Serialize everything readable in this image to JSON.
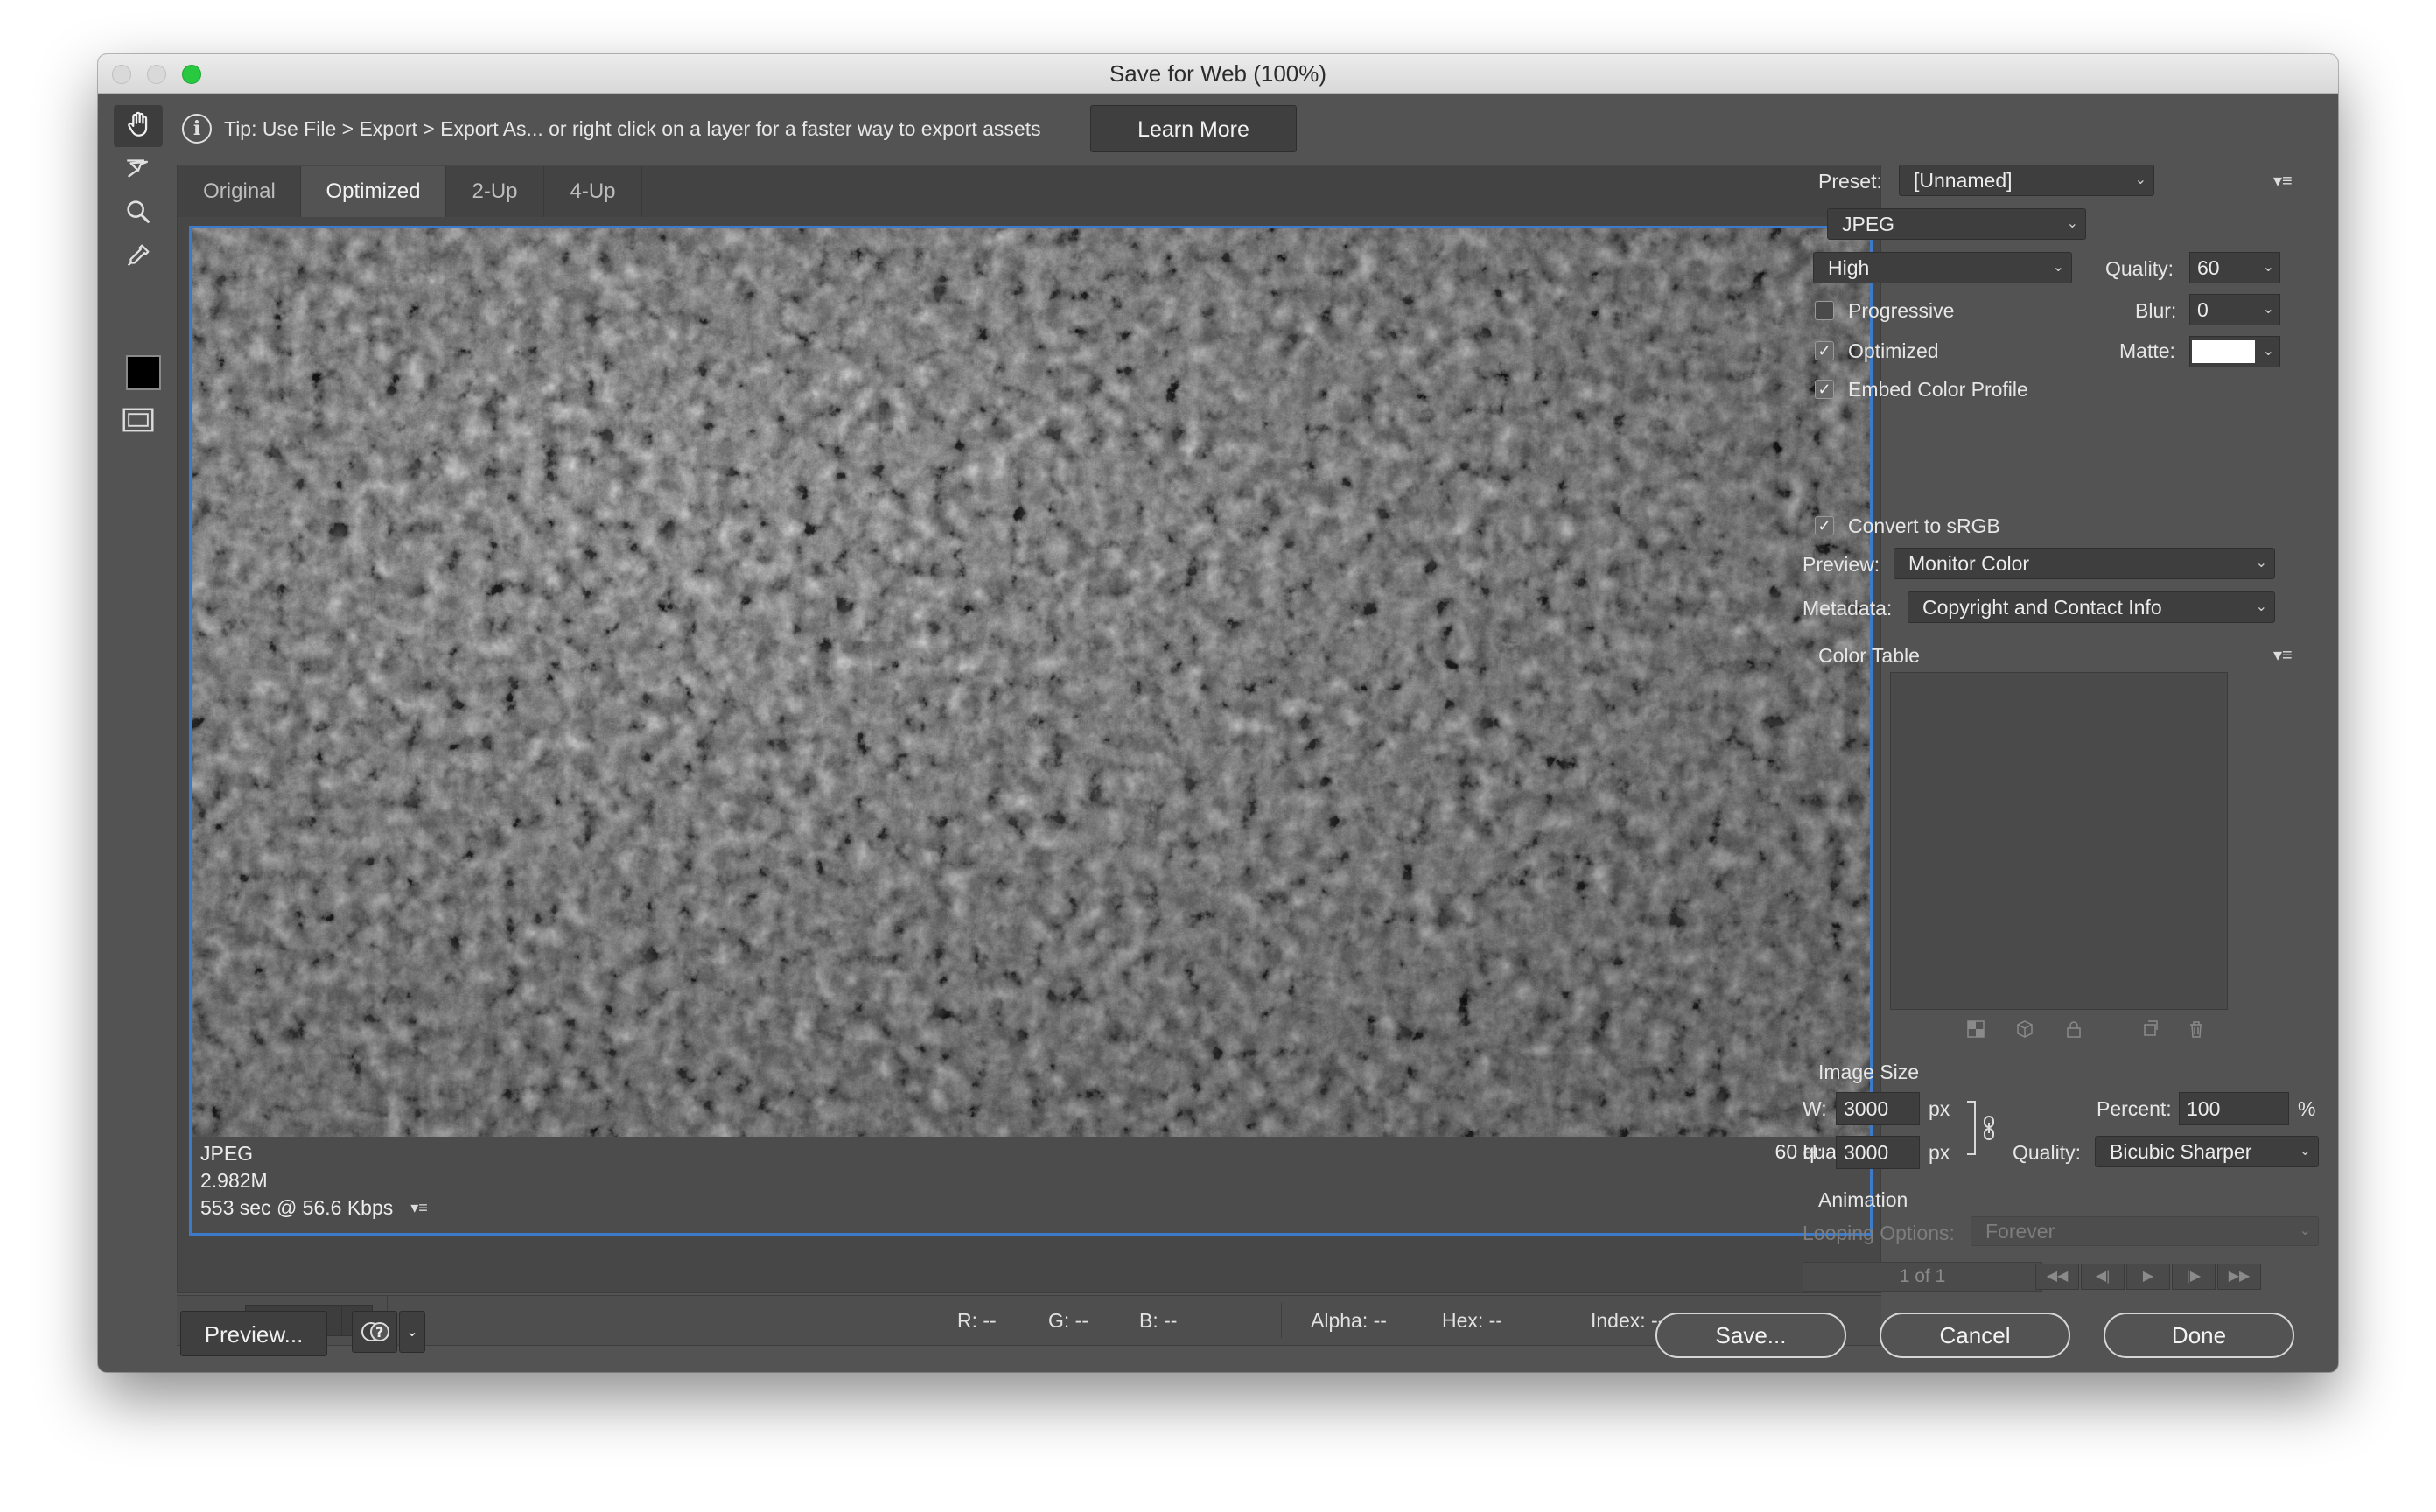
{
  "window": {
    "title": "Save for Web (100%)"
  },
  "tip": {
    "text": "Tip: Use File > Export > Export As...  or right click on a layer for a faster way to export assets",
    "button": "Learn More"
  },
  "tabs": [
    "Original",
    "Optimized",
    "2-Up",
    "4-Up"
  ],
  "active_tab": "Optimized",
  "image_info": {
    "format": "JPEG",
    "size": "2.982M",
    "time": "553 sec @ 56.6 Kbps",
    "quality": "60 quality"
  },
  "status": {
    "zoom": "100%",
    "r": "R: --",
    "g": "G: --",
    "b": "B: --",
    "alpha": "Alpha: --",
    "hex": "Hex: --",
    "index": "Index: --"
  },
  "buttons": {
    "preview": "Preview...",
    "save": "Save...",
    "cancel": "Cancel",
    "done": "Done"
  },
  "settings": {
    "preset_label": "Preset:",
    "preset_value": "[Unnamed]",
    "format": "JPEG",
    "quality_level": "High",
    "quality_label": "Quality:",
    "quality_value": "60",
    "blur_label": "Blur:",
    "blur_value": "0",
    "matte_label": "Matte:",
    "progressive_label": "Progressive",
    "progressive_checked": false,
    "optimized_label": "Optimized",
    "optimized_checked": true,
    "embed_label": "Embed Color Profile",
    "embed_checked": true,
    "srgb_label": "Convert to sRGB",
    "srgb_checked": true,
    "preview_label": "Preview:",
    "preview_value": "Monitor Color",
    "metadata_label": "Metadata:",
    "metadata_value": "Copyright and Contact Info",
    "color_table_label": "Color Table"
  },
  "image_size": {
    "label": "Image Size",
    "w_label": "W:",
    "w_value": "3000",
    "h_label": "H:",
    "h_value": "3000",
    "unit": "px",
    "percent_label": "Percent:",
    "percent_value": "100",
    "percent_unit": "%",
    "quality_label": "Quality:",
    "quality_value": "Bicubic Sharper"
  },
  "animation": {
    "label": "Animation",
    "looping_label": "Looping Options:",
    "looping_value": "Forever",
    "frame": "1 of 1"
  },
  "colors": {
    "selection_border": "#3d7ac9",
    "window_bg": "#535353",
    "close": "#d7d7d7",
    "zoom_light": "#28c840"
  }
}
